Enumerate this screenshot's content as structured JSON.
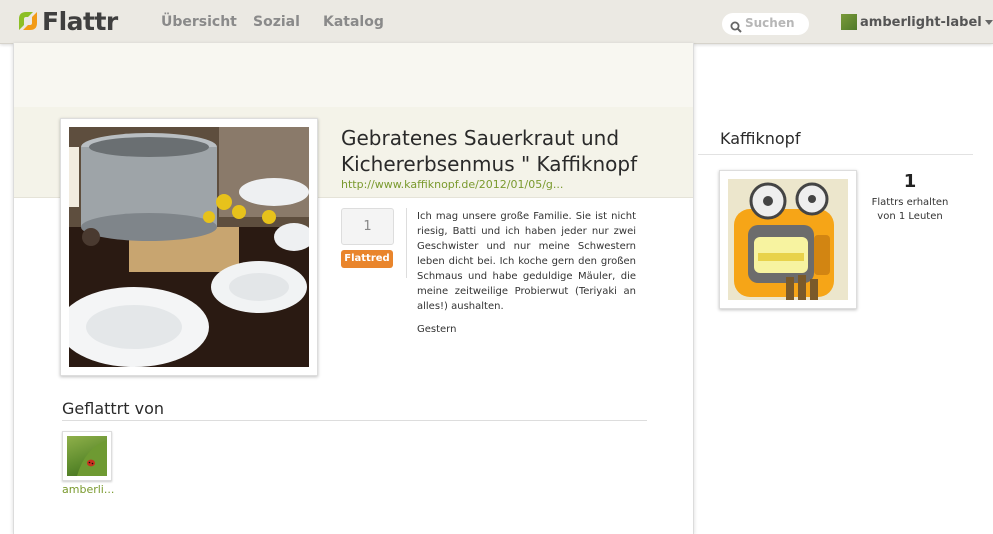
{
  "header": {
    "logo_text": "Flattr",
    "nav": [
      "Übersicht",
      "Sozial",
      "Katalog"
    ],
    "search_placeholder": "Suchen",
    "username": "amberlight-label"
  },
  "thing": {
    "title": "Gebratenes Sauerkraut und Kichererbsenmus \" Kaffiknopf",
    "url": "http://www.kaffiknopf.de/2012/01/05/g...",
    "flattr_count": "1",
    "flattred_label": "Flattred",
    "description": "Ich mag unsere große Familie. Sie ist nicht riesig, Batti und ich haben jeder nur zwei Geschwister und nur meine Schwestern leben dicht bei. Ich koche gern den großen Schmaus und habe geduldige Mäuler, die meine zeitweilige Probierwut (Teriyaki an alles!) aushalten.",
    "date": "Gestern"
  },
  "flattered_by": {
    "title": "Geflattrt von",
    "users": [
      {
        "name": "amberli..."
      }
    ]
  },
  "owner": {
    "name": "Kaffiknopf",
    "count": "1",
    "label": "Flattrs erhalten von 1 Leuten"
  },
  "colors": {
    "accent_green": "#7a9a2e",
    "flattred_orange": "#e9852c",
    "topbar_bg": "#ebe9e3"
  },
  "icons": [
    "flattr-logo-icon",
    "search-icon",
    "chevron-down-icon"
  ]
}
